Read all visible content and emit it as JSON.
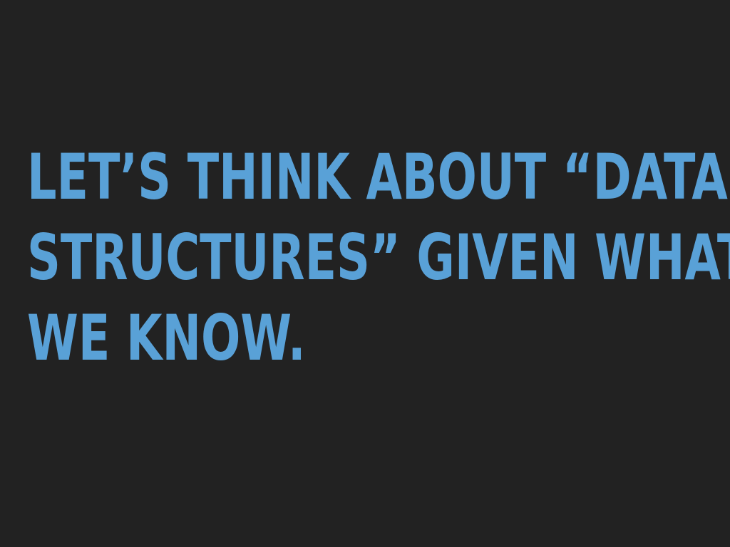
{
  "slide": {
    "lines": [
      "LET’S THINK ABOUT “DATA",
      "STRUCTURES” GIVEN WHAT",
      "WE KNOW."
    ]
  },
  "colors": {
    "background": "#222222",
    "text": "#59a1d7"
  }
}
